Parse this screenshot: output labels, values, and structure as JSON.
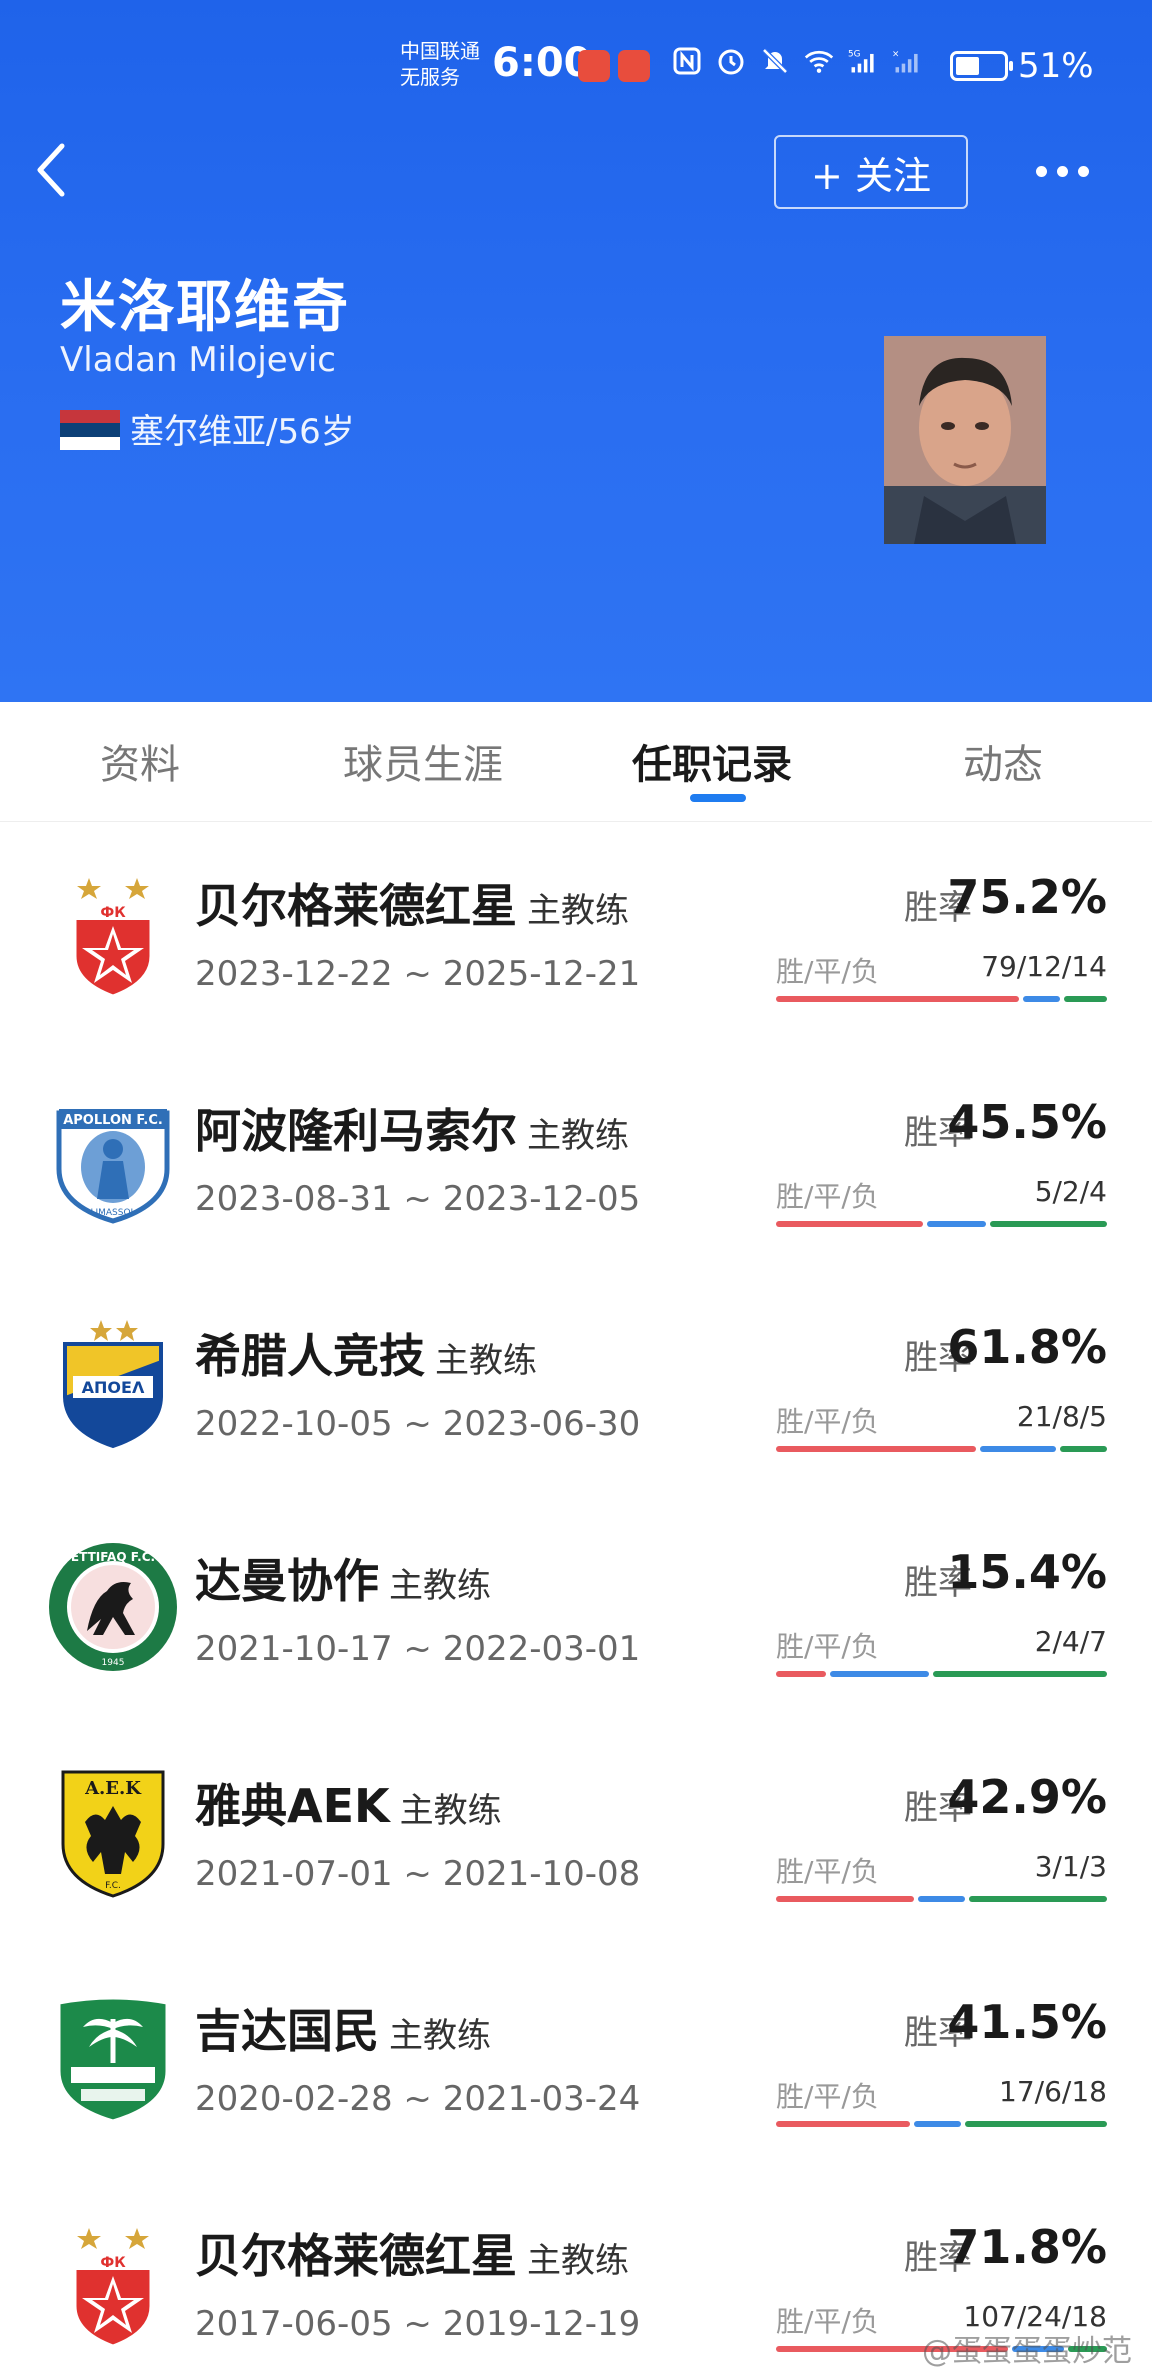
{
  "status_bar": {
    "carrier_line1": "中国联通",
    "carrier_line2": "无服务",
    "time": "6:00",
    "battery_percent": "51%",
    "battery_level": 0.51
  },
  "header": {
    "follow_label": "+ 关注",
    "name_cn": "米洛耶维奇",
    "name_en": "Vladan Milojevic",
    "nationality_age": "塞尔维亚/56岁"
  },
  "tabs": [
    {
      "label": "资料",
      "active": false
    },
    {
      "label": "球员生涯",
      "active": false
    },
    {
      "label": "任职记录",
      "active": true
    },
    {
      "label": "动态",
      "active": false
    }
  ],
  "labels": {
    "win_rate": "胜率",
    "wdl": "胜/平/负"
  },
  "records": [
    {
      "club": "贝尔格莱德红星",
      "role": "主教练",
      "dates": "2023-12-22 ~ 2025-12-21",
      "win_rate": "75.2%",
      "wdl": "79/12/14",
      "w": 79,
      "d": 12,
      "l": 14,
      "logo": "red-star-belgrade-logo"
    },
    {
      "club": "阿波隆利马索尔",
      "role": "主教练",
      "dates": "2023-08-31 ~ 2023-12-05",
      "win_rate": "45.5%",
      "wdl": "5/2/4",
      "w": 5,
      "d": 2,
      "l": 4,
      "logo": "apollon-limassol-logo"
    },
    {
      "club": "希腊人竞技",
      "role": "主教练",
      "dates": "2022-10-05 ~ 2023-06-30",
      "win_rate": "61.8%",
      "wdl": "21/8/5",
      "w": 21,
      "d": 8,
      "l": 5,
      "logo": "apoel-logo"
    },
    {
      "club": "达曼协作",
      "role": "主教练",
      "dates": "2021-10-17 ~ 2022-03-01",
      "win_rate": "15.4%",
      "wdl": "2/4/7",
      "w": 2,
      "d": 4,
      "l": 7,
      "logo": "ettifaq-logo"
    },
    {
      "club": "雅典AEK",
      "role": "主教练",
      "dates": "2021-07-01 ~ 2021-10-08",
      "win_rate": "42.9%",
      "wdl": "3/1/3",
      "w": 3,
      "d": 1,
      "l": 3,
      "logo": "aek-athens-logo"
    },
    {
      "club": "吉达国民",
      "role": "主教练",
      "dates": "2020-02-28 ~ 2021-03-24",
      "win_rate": "41.5%",
      "wdl": "17/6/18",
      "w": 17,
      "d": 6,
      "l": 18,
      "logo": "al-ahli-jeddah-logo"
    },
    {
      "club": "贝尔格莱德红星",
      "role": "主教练",
      "dates": "2017-06-05 ~ 2019-12-19",
      "win_rate": "71.8%",
      "wdl": "107/24/18",
      "w": 107,
      "d": 24,
      "l": 18,
      "logo": "red-star-belgrade-logo"
    }
  ],
  "watermark": "@蛋蛋蛋蛋炒范",
  "colors": {
    "header_blue": "#1f63ea",
    "win": "#e95a5f",
    "draw": "#3d8ae6",
    "loss": "#2a9a55",
    "tab_indicator": "#1f7cf0"
  }
}
